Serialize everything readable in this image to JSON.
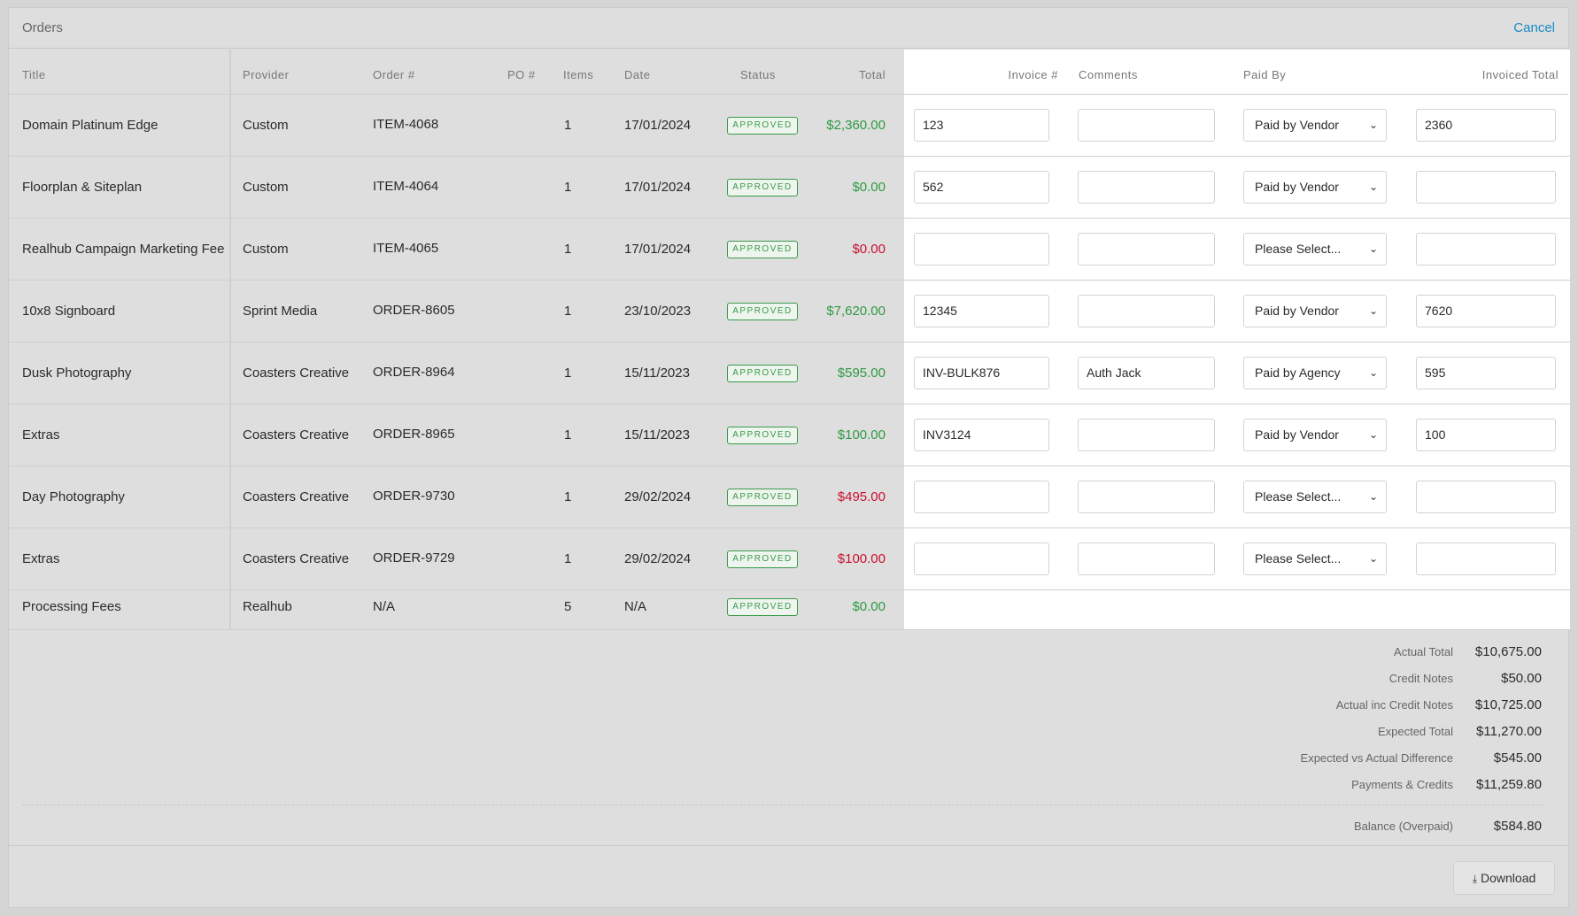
{
  "header": {
    "title": "Orders",
    "cancel_label": "Cancel"
  },
  "columns": {
    "title": "Title",
    "provider": "Provider",
    "order": "Order #",
    "po": "PO #",
    "items": "Items",
    "date": "Date",
    "status": "Status",
    "total": "Total",
    "invoice": "Invoice #",
    "comments": "Comments",
    "paid_by": "Paid By",
    "invoiced_total": "Invoiced Total"
  },
  "rows": [
    {
      "title": "Domain Platinum Edge",
      "provider": "Custom",
      "order": "ITEM-4068",
      "items": "1",
      "date": "17/01/2024",
      "status": "APPROVED",
      "total": "$2,360.00",
      "total_color": "green",
      "invoice": "123",
      "comments": "",
      "paid_by": "Paid by Vendor",
      "invoiced_total": "2360"
    },
    {
      "title": "Floorplan & Siteplan",
      "provider": "Custom",
      "order": "ITEM-4064",
      "items": "1",
      "date": "17/01/2024",
      "status": "APPROVED",
      "total": "$0.00",
      "total_color": "green",
      "invoice": "562",
      "comments": "",
      "paid_by": "Paid by Vendor",
      "invoiced_total": ""
    },
    {
      "title": "Realhub Campaign Marketing Fee",
      "provider": "Custom",
      "order": "ITEM-4065",
      "items": "1",
      "date": "17/01/2024",
      "status": "APPROVED",
      "total": "$0.00",
      "total_color": "red",
      "invoice": "",
      "comments": "",
      "paid_by": "Please Select...",
      "invoiced_total": ""
    },
    {
      "title": "10x8 Signboard",
      "provider": "Sprint Media",
      "order": "ORDER-8605",
      "items": "1",
      "date": "23/10/2023",
      "status": "APPROVED",
      "total": "$7,620.00",
      "total_color": "green",
      "invoice": "12345",
      "comments": "",
      "paid_by": "Paid by Vendor",
      "invoiced_total": "7620"
    },
    {
      "title": "Dusk Photography",
      "provider": "Coasters Creative",
      "order": "ORDER-8964",
      "items": "1",
      "date": "15/11/2023",
      "status": "APPROVED",
      "total": "$595.00",
      "total_color": "green",
      "invoice": "INV-BULK876",
      "comments": "Auth Jack",
      "paid_by": "Paid by Agency",
      "invoiced_total": "595"
    },
    {
      "title": "Extras",
      "provider": "Coasters Creative",
      "order": "ORDER-8965",
      "items": "1",
      "date": "15/11/2023",
      "status": "APPROVED",
      "total": "$100.00",
      "total_color": "green",
      "invoice": "INV3124",
      "comments": "",
      "paid_by": "Paid by Vendor",
      "invoiced_total": "100"
    },
    {
      "title": "Day Photography",
      "provider": "Coasters Creative",
      "order": "ORDER-9730",
      "items": "1",
      "date": "29/02/2024",
      "status": "APPROVED",
      "total": "$495.00",
      "total_color": "red",
      "invoice": "",
      "comments": "",
      "paid_by": "Please Select...",
      "invoiced_total": ""
    },
    {
      "title": "Extras",
      "provider": "Coasters Creative",
      "order": "ORDER-9729",
      "items": "1",
      "date": "29/02/2024",
      "status": "APPROVED",
      "total": "$100.00",
      "total_color": "red",
      "invoice": "",
      "comments": "",
      "paid_by": "Please Select...",
      "invoiced_total": ""
    }
  ],
  "fees_row": {
    "title": "Processing Fees",
    "provider": "Realhub",
    "order": "N/A",
    "items": "5",
    "date": "N/A",
    "status": "APPROVED",
    "total": "$0.00"
  },
  "summary": [
    {
      "label": "Actual Total",
      "value": "$10,675.00"
    },
    {
      "label": "Credit Notes",
      "value": "$50.00"
    },
    {
      "label": "Actual inc Credit Notes",
      "value": "$10,725.00"
    },
    {
      "label": "Expected Total",
      "value": "$11,270.00"
    },
    {
      "label": "Expected vs Actual Difference",
      "value": "$545.00"
    },
    {
      "label": "Payments & Credits",
      "value": "$11,259.80"
    }
  ],
  "balance": {
    "label": "Balance (Overpaid)",
    "value": "$584.80"
  },
  "footer": {
    "download_label": "Download"
  },
  "colors": {
    "green": "#2e9a43",
    "red": "#c8102e",
    "link": "#1a8bc4"
  }
}
